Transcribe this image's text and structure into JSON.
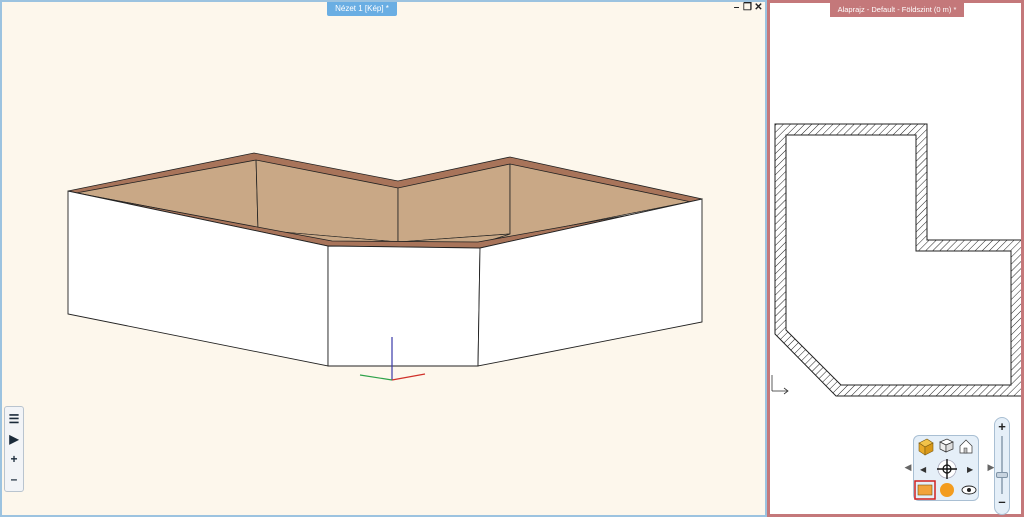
{
  "view3d": {
    "title": "Nézet 1 [Kép] *",
    "controls": {
      "minimize": "–",
      "restore": "❐",
      "close": "✕"
    },
    "tools": {
      "menu": "☰",
      "play": "▶",
      "plus": "+",
      "minus": "–"
    },
    "colors": {
      "background": "#fdf7ec",
      "wall_top": "#a8745a",
      "wall_inner": "#c9a886",
      "wall_outer": "#ffffff",
      "border": "#9cc3e0"
    }
  },
  "floorplan": {
    "title": "Alaprajz - Default - Földszint (0 m) *",
    "colors": {
      "border": "#c4787a",
      "hatch": "#222222"
    },
    "nav": {
      "left": "◀",
      "right": "▶",
      "zoom_in": "+",
      "zoom_out": "–",
      "zoom_level": 0.3
    }
  }
}
